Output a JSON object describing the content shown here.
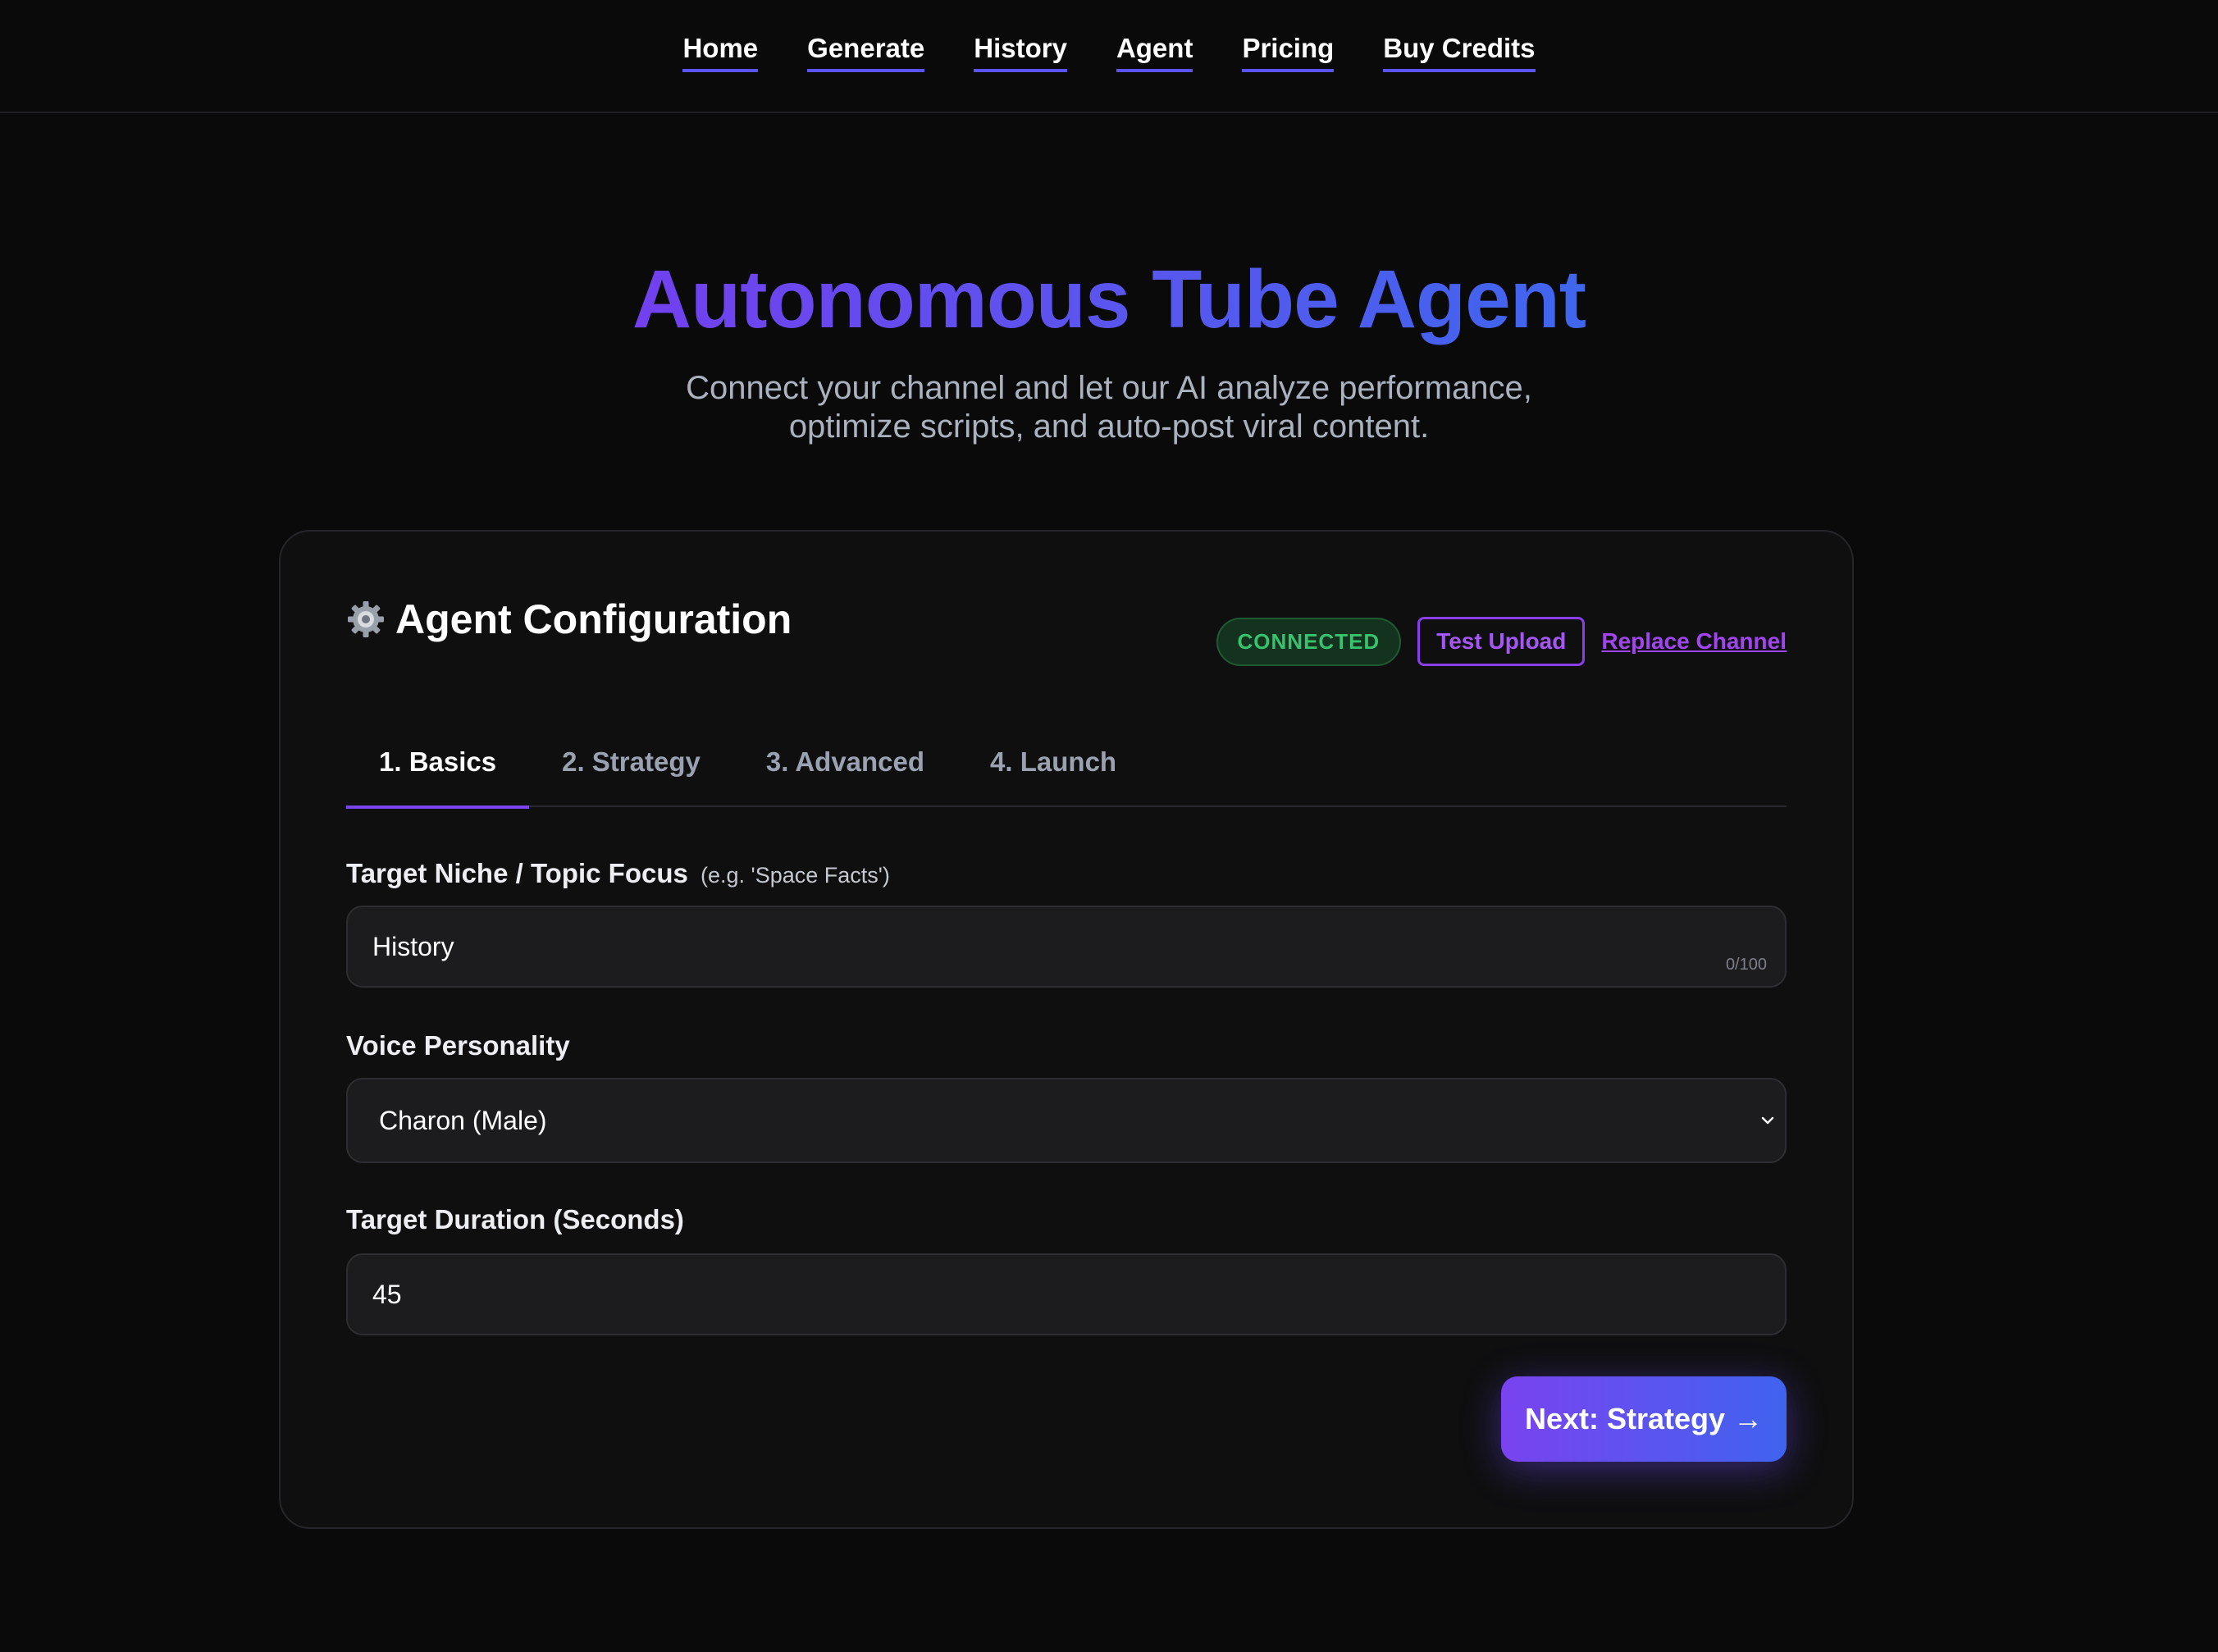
{
  "nav": {
    "items": [
      {
        "label": "Home"
      },
      {
        "label": "Generate"
      },
      {
        "label": "History"
      },
      {
        "label": "Agent"
      },
      {
        "label": "Pricing"
      },
      {
        "label": "Buy Credits"
      }
    ]
  },
  "hero": {
    "title": "Autonomous Tube Agent",
    "subtitle_line1": "Connect your channel and let our AI analyze performance,",
    "subtitle_line2": "optimize scripts, and auto-post viral content."
  },
  "card": {
    "icon": "gear-icon",
    "title": "Agent Configuration",
    "status_badge": "CONNECTED",
    "test_upload_label": "Test Upload",
    "replace_channel_label": "Replace Channel",
    "tabs": [
      {
        "label": "1. Basics",
        "active": true
      },
      {
        "label": "2. Strategy",
        "active": false
      },
      {
        "label": "3. Advanced",
        "active": false
      },
      {
        "label": "4. Launch",
        "active": false
      }
    ],
    "fields": {
      "niche": {
        "label": "Target Niche / Topic Focus",
        "hint": "(e.g. 'Space Facts')",
        "value": "History",
        "char_count": "0/100"
      },
      "voice": {
        "label": "Voice Personality",
        "selected": "Charon (Male)"
      },
      "duration": {
        "label": "Target Duration (Seconds)",
        "value": "45"
      }
    },
    "next_button_label": "Next: Strategy →"
  },
  "colors": {
    "background": "#0a0a0a",
    "card": "#0f0f10",
    "accent_purple": "#7a43f0",
    "accent_blue": "#3f63ef",
    "connected_green": "#38c26d"
  }
}
